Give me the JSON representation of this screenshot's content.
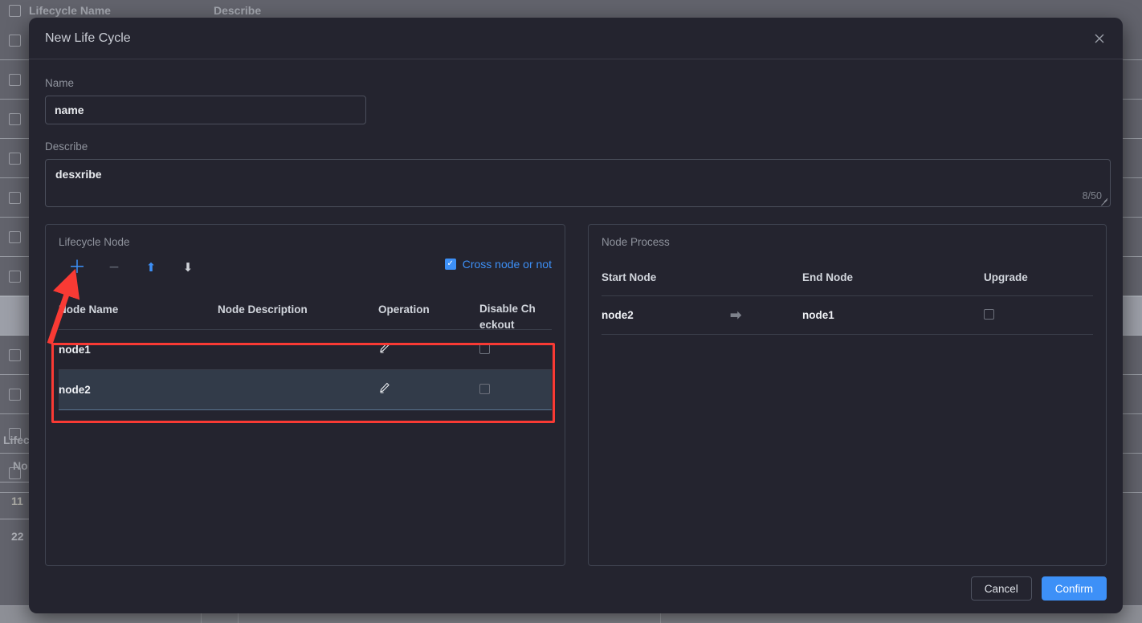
{
  "background": {
    "header": {
      "checkbox_icon": "checkbox-icon",
      "col1": "Lifecycle Name",
      "col2": "Describe"
    },
    "rows_count": 12,
    "selected_row_index": 7,
    "lifecycle_label": "Lifecy",
    "nodes_label": "No",
    "values": [
      "11",
      "22"
    ]
  },
  "modal": {
    "title": "New Life Cycle",
    "close_icon": "close-icon",
    "name": {
      "label": "Name",
      "value": "name",
      "placeholder": "name"
    },
    "describe": {
      "label": "Describe",
      "value": "desxribe",
      "placeholder": "describe",
      "counter": "8/50",
      "resize_icon": "resize-handle-icon"
    },
    "left_panel": {
      "title": "Lifecycle Node",
      "toolbar": [
        {
          "name": "add-node-button",
          "glyph": "＋",
          "state": "enabled"
        },
        {
          "name": "remove-node-button",
          "glyph": "−",
          "state": "disabled"
        },
        {
          "name": "move-up-button",
          "glyph": "⬆",
          "state": "enabled"
        },
        {
          "name": "move-down-button",
          "glyph": "⬇",
          "state": "muted"
        }
      ],
      "cross_node": {
        "label": "Cross node or not",
        "checked": true,
        "check_glyph": "✓"
      },
      "columns": [
        "Node Name",
        "Node Description",
        "Operation",
        "Disable Ch eckout"
      ],
      "rows": [
        {
          "node_name": "node1",
          "node_description": "",
          "operation_icon": "edit-pencil-icon",
          "disable_checkout": false,
          "selected": false
        },
        {
          "node_name": "node2",
          "node_description": "",
          "operation_icon": "edit-pencil-icon",
          "disable_checkout": false,
          "selected": true
        }
      ]
    },
    "right_panel": {
      "title": "Node Process",
      "columns": [
        "Start Node",
        "End Node",
        "Upgrade"
      ],
      "rows": [
        {
          "start_node": "node2",
          "arrow_icon": "arrow-right-icon",
          "arrow_glyph": "➡",
          "end_node": "node1",
          "upgrade": false
        }
      ]
    },
    "footer": {
      "cancel_label": "Cancel",
      "confirm_label": "Confirm"
    }
  },
  "annotations": {
    "arrow_color": "#f93a34",
    "box_color": "#f93a34",
    "arrow_points_to": "add-node-button",
    "box_surrounds": "lifecycle-node-rows"
  },
  "colors": {
    "accent": "#3d90f7",
    "modal_bg": "#24242f",
    "panel_border": "#3f4350",
    "row_selected": "#323b49",
    "annotation_red": "#f93a34"
  }
}
